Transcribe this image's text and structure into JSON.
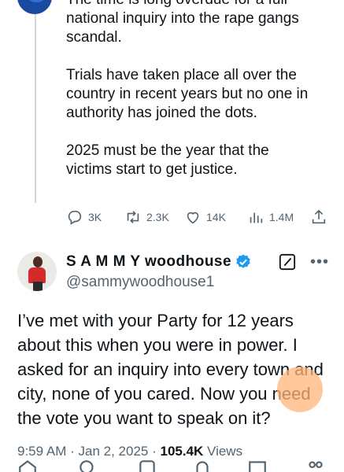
{
  "parent_tweet": {
    "partial_first_line": "The time is long overdue for a full",
    "paragraphs": [
      "national inquiry into the rape gangs\nscandal.",
      "Trials have taken place all over the\ncountry in recent years but no one in\nauthority has joined the dots.",
      "2025 must be the year that the\nvictims start to get justice."
    ],
    "stats": {
      "replies": "3K",
      "retweets": "2.3K",
      "likes": "14K",
      "views": "1.4M"
    }
  },
  "reply_tweet": {
    "display_name": "S A M M Y woodhouse",
    "handle": "@sammywoodhouse1",
    "text": "I’ve met with your Party for 12 years about this when you were in power. I asked for an inquiry into every town and city, none of you cared. Now you need the vote you want to speak on it?",
    "time": "9:59 AM",
    "date": "Jan 2, 2025",
    "views_count": "105.4K",
    "views_label": "Views"
  },
  "colors": {
    "text": "#0f1419",
    "secondary": "#536471",
    "verified": "#1d9bf0",
    "thread_line": "#cfd9de"
  },
  "icons": [
    "reply-icon",
    "retweet-icon",
    "like-icon",
    "views-icon",
    "share-icon",
    "verified-icon",
    "grok-icon",
    "more-icon"
  ]
}
